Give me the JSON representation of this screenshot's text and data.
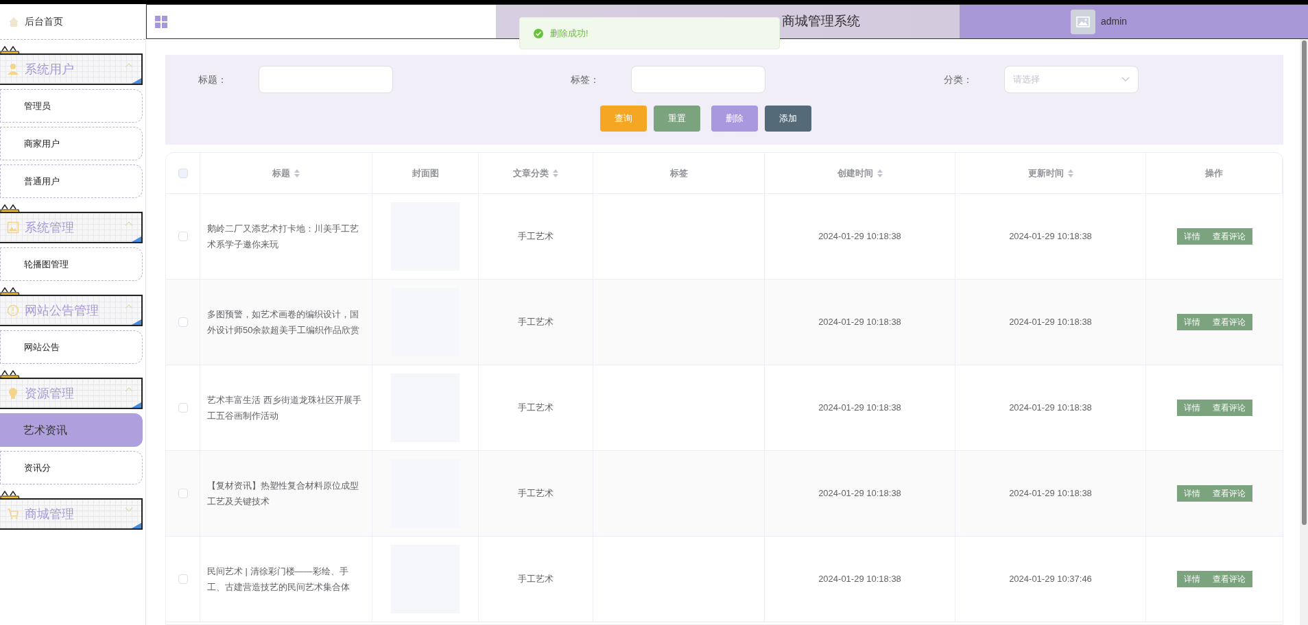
{
  "header": {
    "title": "商城管理系统",
    "user": "admin"
  },
  "toast": {
    "message": "删除成功!"
  },
  "sidebar": {
    "home": "后台首页",
    "groups": [
      {
        "title": "系统用户",
        "expanded": true,
        "children": [
          {
            "label": "管理员",
            "selected": false
          },
          {
            "label": "商家用户",
            "selected": false
          },
          {
            "label": "普通用户",
            "selected": false
          }
        ]
      },
      {
        "title": "系统管理",
        "expanded": true,
        "children": [
          {
            "label": "轮播图管理",
            "selected": false
          }
        ]
      },
      {
        "title": "网站公告管理",
        "expanded": true,
        "children": [
          {
            "label": "网站公告",
            "selected": false
          }
        ]
      },
      {
        "title": "资源管理",
        "expanded": true,
        "children": [
          {
            "label": "艺术资讯",
            "selected": true
          },
          {
            "label": "资讯分",
            "selected": false
          }
        ]
      },
      {
        "title": "商城管理",
        "expanded": false
      }
    ]
  },
  "filters": [
    {
      "kind": "text",
      "label": "标题："
    },
    {
      "kind": "text",
      "label": "标签："
    },
    {
      "kind": "select",
      "label": "分类：",
      "placeholder": "请选择"
    }
  ],
  "actions": [
    {
      "label": "查询",
      "color": "#f5a623"
    },
    {
      "label": "重置",
      "color": "#7ba37e"
    },
    {
      "label": "删除",
      "color": "#a898dd"
    },
    {
      "label": "添加",
      "color": "#546a79"
    }
  ],
  "table": {
    "select_all": {
      "checked": false
    },
    "columns": [
      {
        "label": "标题",
        "sortable": true
      },
      {
        "label": "封面图",
        "sortable": false
      },
      {
        "label": "文章分类",
        "sortable": true
      },
      {
        "label": "标签",
        "sortable": false
      },
      {
        "label": "创建时间",
        "sortable": true
      },
      {
        "label": "更新时间",
        "sortable": true
      },
      {
        "label": "操作",
        "sortable": false
      }
    ],
    "rows": [
      {
        "checked": false,
        "title": "鹅岭二厂又添艺术打卡地：川美手工艺术系学子邀你来玩",
        "category": "手工艺术",
        "created": "2024-01-29 10:18:38",
        "updated": "2024-01-29 10:18:38",
        "buttons": [
          "详情",
          "查看评论"
        ]
      },
      {
        "checked": false,
        "title": "多图预警，如艺术画卷的编织设计，国外设计师50余款超美手工编织作品欣赏",
        "category": "手工艺术",
        "created": "2024-01-29 10:18:38",
        "updated": "2024-01-29 10:18:38",
        "buttons": [
          "详情",
          "查看评论"
        ]
      },
      {
        "checked": false,
        "title": "艺术丰富生活 西乡街道龙珠社区开展手工五谷画制作活动",
        "category": "手工艺术",
        "created": "2024-01-29 10:18:38",
        "updated": "2024-01-29 10:18:38",
        "buttons": [
          "详情",
          "查看评论"
        ]
      },
      {
        "checked": false,
        "title": "【复材资讯】热塑性复合材料原位成型工艺及关键技术",
        "category": "手工艺术",
        "created": "2024-01-29 10:18:38",
        "updated": "2024-01-29 10:18:38",
        "buttons": [
          "详情",
          "查看评论"
        ]
      },
      {
        "checked": false,
        "title": "民间艺术 | 清徐彩门楼——彩绘、手工、古建营造技艺的民间艺术集合体",
        "category": "手工艺术",
        "created": "2024-01-29 10:18:38",
        "updated": "2024-01-29 10:37:46",
        "buttons": [
          "详情",
          "查看评论"
        ]
      }
    ]
  }
}
